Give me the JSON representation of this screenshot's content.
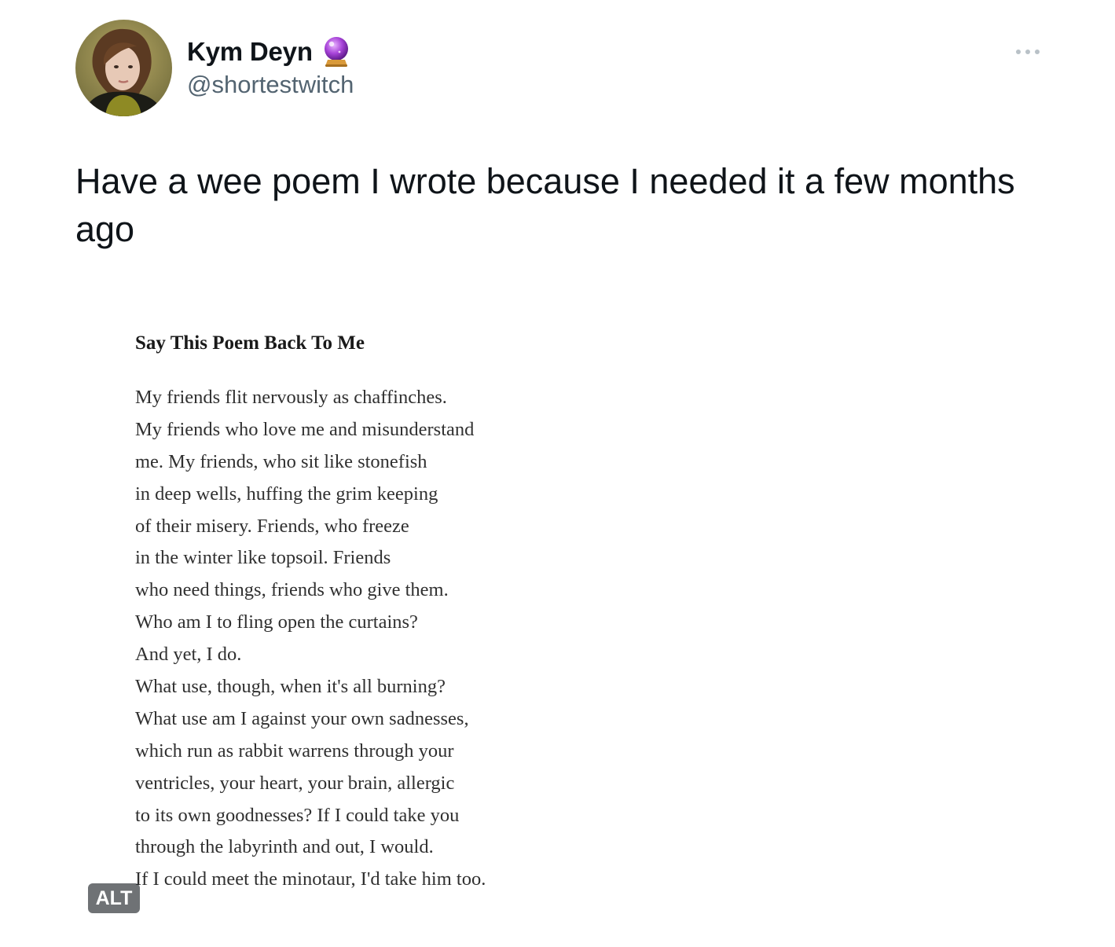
{
  "author": {
    "display_name": "Kym Deyn",
    "handle": "@shortestwitch",
    "name_emoji": "crystal-ball-icon"
  },
  "tweet": {
    "text": "Have a wee poem I wrote because I needed it a few months ago"
  },
  "media": {
    "alt_label": "ALT",
    "poem": {
      "title": "Say This Poem Back To Me",
      "lines": [
        "My friends flit nervously as chaffinches.",
        "My friends who love me and misunderstand",
        "me. My friends, who sit like stonefish",
        "in deep wells, huffing the grim keeping",
        "of their misery. Friends, who freeze",
        "in the winter like topsoil. Friends",
        "who need things, friends who give them.",
        "Who am I to fling open the curtains?",
        "And yet, I do.",
        "What use, though, when it's all burning?",
        "What use am I against your own sadnesses,",
        "which run as rabbit warrens through your",
        "ventricles, your heart, your brain, allergic",
        "to its own goodnesses? If I could take you",
        "through the labyrinth and out, I would.",
        "If I could meet the minotaur, I'd take him too."
      ]
    }
  },
  "colors": {
    "text_primary": "#0f1419",
    "text_secondary": "#536471",
    "alt_badge_bg": "#0f1419"
  }
}
